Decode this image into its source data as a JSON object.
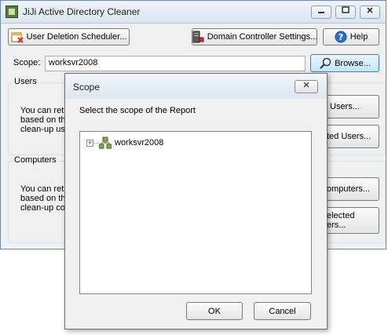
{
  "main_window": {
    "title": "JiJi Active Directory Cleaner",
    "toolbar": {
      "scheduler_label": "User Deletion Scheduler...",
      "dc_settings_label": "Domain Controller Settings...",
      "help_label": "Help"
    },
    "scope": {
      "label": "Scope:",
      "value": "worksvr2008",
      "browse_label": "Browse..."
    },
    "users": {
      "title": "Users",
      "description": [
        "You can ret",
        "based on the",
        "clean-up user"
      ],
      "button1": "Users...",
      "button2": "ted Users..."
    },
    "computers": {
      "title": "Computers",
      "description": [
        "You can ret",
        "based on the",
        "clean-up com"
      ],
      "button1": "omputers...",
      "button2_line1": "elected",
      "button2_line2": "ers..."
    }
  },
  "dialog": {
    "title": "Scope",
    "prompt": "Select the scope of the Report",
    "tree": {
      "root": {
        "label": "worksvr2008",
        "expander": "+",
        "icon": "network-domain-icon"
      }
    },
    "ok_label": "OK",
    "cancel_label": "Cancel"
  },
  "colors": {
    "window_bg": "#f0f0f0",
    "titlebar_bg": "#dbe6f3",
    "browse_highlight": "#bee6fd"
  }
}
